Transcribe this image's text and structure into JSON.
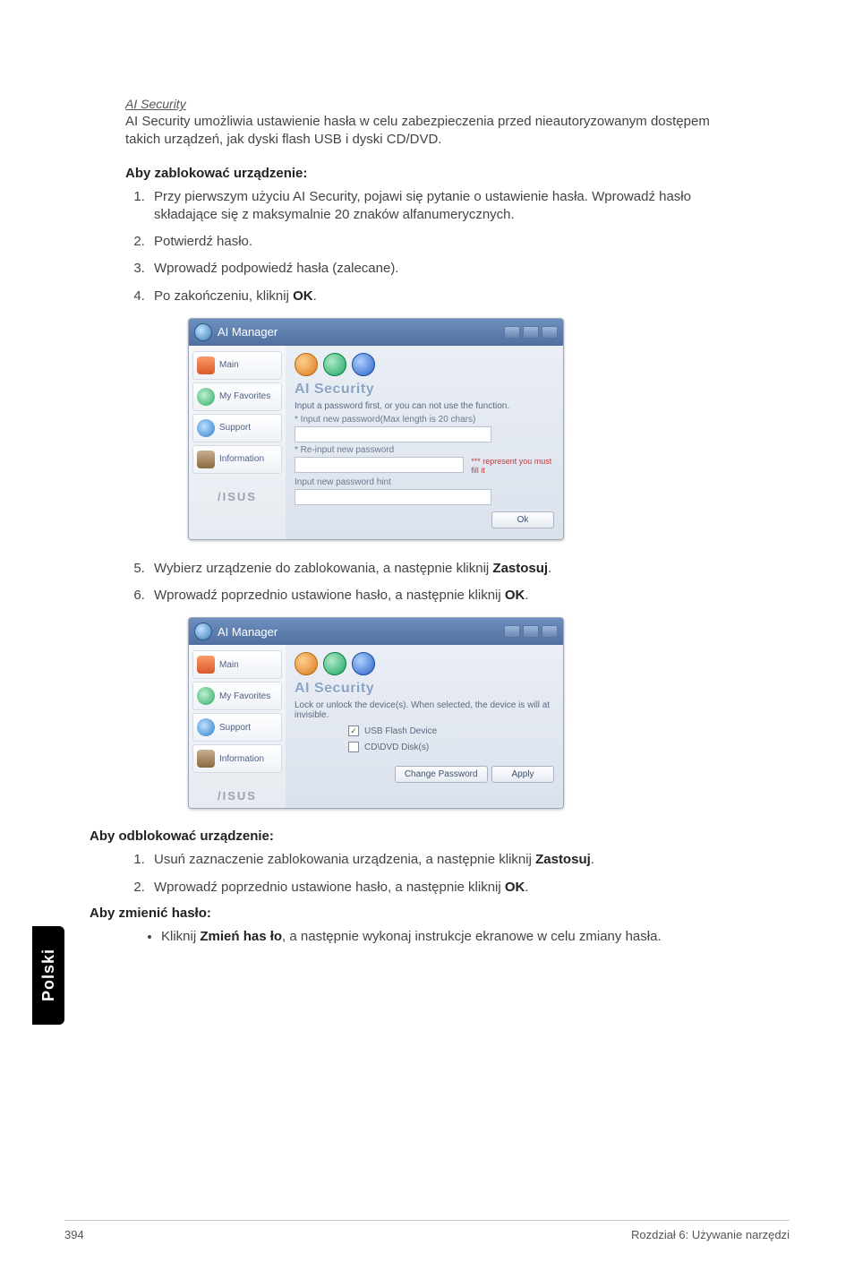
{
  "section_title": "AI Security",
  "intro_html": "AI Security umożliwia ustawienie hasła w celu zabezpieczenia przed nieautoryzowanym dostępem takich urządzeń, jak dyski flash USB i dyski CD/DVD.",
  "lock_heading": "Aby zablokować urządzenie:",
  "lock_steps": [
    "Przy pierwszym użyciu AI Security, pojawi się pytanie o ustawienie hasła. Wprowadź hasło składające się z maksymalnie 20 znaków alfanumerycznych.",
    "Potwierdź hasło.",
    "Wprowadź podpowiedź hasła (zalecane).",
    "Po zakończeniu, kliknij <b>OK</b>."
  ],
  "screenshot1": {
    "app_title": "AI Manager",
    "sidebar": [
      "Main",
      "My Favorites",
      "Support",
      "Information"
    ],
    "brand": "/ISUS",
    "panel_title": "AI Security",
    "hint": "Input a password first, or you can not use the function.",
    "sub1": "* Input new password(Max length is 20 chars)",
    "sub2": "* Re-input new password",
    "warn": "*** represent you must fill it",
    "sub3": "Input new password hint",
    "ok": "Ok"
  },
  "lock_steps2": [
    "Wybierz urządzenie do zablokowania, a następnie kliknij <b>Zastosuj</b>.",
    "Wprowadź poprzednio ustawione hasło, a następnie kliknij <b>OK</b>."
  ],
  "screenshot2": {
    "app_title": "AI Manager",
    "sidebar": [
      "Main",
      "My Favorites",
      "Support",
      "Information"
    ],
    "brand": "/ISUS",
    "panel_title": "AI Security",
    "hint": "Lock or unlock the device(s). When selected, the device is will at invisible.",
    "chk1": "USB Flash Device",
    "chk2": "CD\\DVD Disk(s)",
    "btn_change": "Change Password",
    "btn_apply": "Apply"
  },
  "unlock_heading": "Aby odblokować urządzenie:",
  "unlock_steps": [
    "Usuń zaznaczenie zablokowania urządzenia, a następnie kliknij <b>Zastosuj</b>.",
    "Wprowadź poprzednio ustawione hasło, a następnie kliknij <b>OK</b>."
  ],
  "change_heading": "Aby zmienić hasło:",
  "change_bullet": "Kliknij <b>Zmień has ło</b>, a następnie wykonaj instrukcje ekranowe w celu zmiany hasła.",
  "lang_tab": "Polski",
  "page_num": "394",
  "footer_right": "Rozdział 6: Używanie narzędzi"
}
